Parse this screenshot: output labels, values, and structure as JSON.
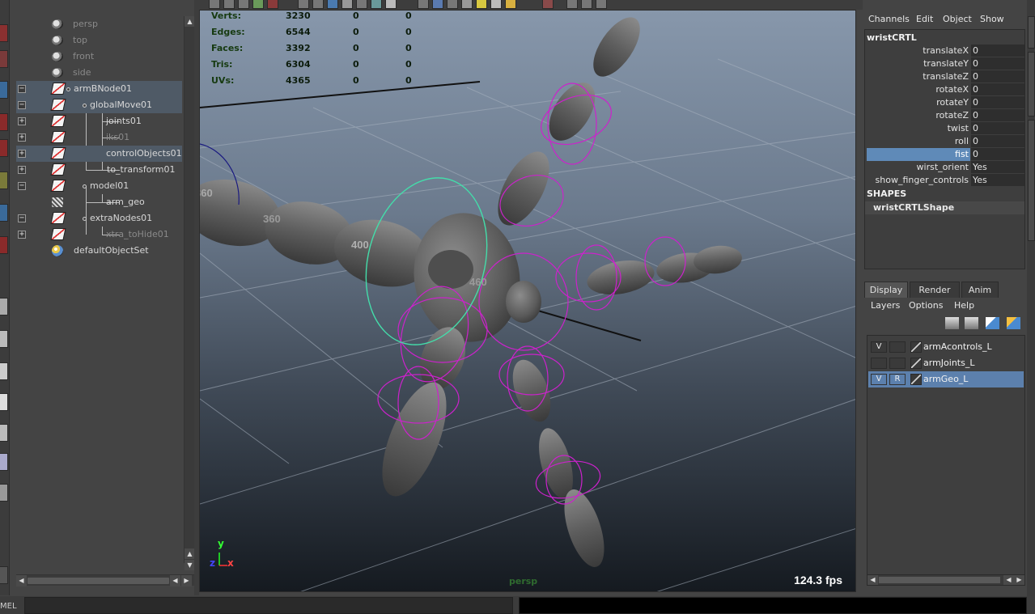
{
  "outliner": {
    "items": [
      {
        "label": "persp",
        "icon": "camera-icon",
        "dim": true
      },
      {
        "label": "top",
        "icon": "camera-icon",
        "dim": true
      },
      {
        "label": "front",
        "icon": "camera-icon",
        "dim": true
      },
      {
        "label": "side",
        "icon": "camera-icon",
        "dim": true
      },
      {
        "label": "armBNode01",
        "icon": "transform-icon",
        "expand": "−"
      },
      {
        "label": "globalMove01",
        "icon": "transform-icon",
        "expand": "−"
      },
      {
        "label": "joints01",
        "icon": "transform-icon",
        "expand": "+"
      },
      {
        "label": "iks01",
        "icon": "transform-icon",
        "expand": "+",
        "dim": true
      },
      {
        "label": "controlObjects01",
        "icon": "transform-icon",
        "expand": "+"
      },
      {
        "label": "to_transform01",
        "icon": "transform-icon",
        "expand": "+"
      },
      {
        "label": "model01",
        "icon": "transform-icon",
        "expand": "−"
      },
      {
        "label": "arm_geo",
        "icon": "mesh-icon"
      },
      {
        "label": "extraNodes01",
        "icon": "transform-icon",
        "expand": "−"
      },
      {
        "label": "xtra_toHide01",
        "icon": "transform-icon",
        "expand": "+",
        "dim": true
      },
      {
        "label": "defaultObjectSet",
        "icon": "object-set-icon"
      }
    ]
  },
  "viewport": {
    "hud": [
      {
        "label": "Verts:",
        "v1": "3230",
        "v2": "0",
        "v3": "0"
      },
      {
        "label": "Edges:",
        "v1": "6544",
        "v2": "0",
        "v3": "0"
      },
      {
        "label": "Faces:",
        "v1": "3392",
        "v2": "0",
        "v3": "0"
      },
      {
        "label": "Tris:",
        "v1": "6304",
        "v2": "0",
        "v3": "0"
      },
      {
        "label": "UVs:",
        "v1": "4365",
        "v2": "0",
        "v3": "0"
      }
    ],
    "fps": "124.3 fps",
    "camera": "persp",
    "grid_labels": [
      "360",
      "400",
      "460"
    ],
    "axis": {
      "x": "x",
      "y": "y",
      "z": "z"
    }
  },
  "channel_box": {
    "menu": [
      "Channels",
      "Edit",
      "Object",
      "Show"
    ],
    "node": "wristCRTL",
    "attributes": [
      {
        "name": "translateX",
        "value": "0"
      },
      {
        "name": "translateY",
        "value": "0"
      },
      {
        "name": "translateZ",
        "value": "0"
      },
      {
        "name": "rotateX",
        "value": "0"
      },
      {
        "name": "rotateY",
        "value": "0"
      },
      {
        "name": "rotateZ",
        "value": "0"
      },
      {
        "name": "twist",
        "value": "0"
      },
      {
        "name": "roll",
        "value": "0"
      },
      {
        "name": "fist",
        "value": "0",
        "selected": true
      },
      {
        "name": "wirst_orient",
        "value": "Yes"
      },
      {
        "name": "show_finger_controls",
        "value": "Yes"
      }
    ],
    "shapes_header": "SHAPES",
    "shape_name": "wristCRTLShape"
  },
  "layer_editor": {
    "tabs": [
      "Display",
      "Render",
      "Anim"
    ],
    "active_tab": "Display",
    "menu": [
      "Layers",
      "Options",
      "Help"
    ],
    "layers": [
      {
        "name": "armAcontrols_L",
        "visible": "V",
        "ref": ""
      },
      {
        "name": "armJoints_L",
        "visible": "",
        "ref": ""
      },
      {
        "name": "armGeo_L",
        "visible": "V",
        "ref": "R",
        "selected": true
      }
    ]
  },
  "command_line": {
    "label": "MEL",
    "value": ""
  },
  "colors": {
    "selection": "#5f8ab8",
    "control_curve": "#cc22cc",
    "selected_curve": "#44ddaa",
    "hud_text": "#163a10"
  }
}
